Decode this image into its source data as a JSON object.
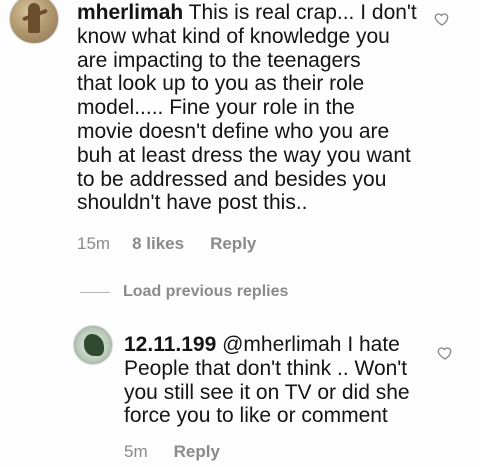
{
  "comment": {
    "username": "mherlimah",
    "lines": [
      "This is real crap... I don't",
      "know what kind of knowledge you",
      "are impacting to the teenagers",
      "that look up to you as their role",
      "model..... Fine your role in the",
      "movie doesn't define who you are",
      "buh at least dress the way you want",
      "to be addressed and besides you",
      "shouldn't have post this.."
    ],
    "time": "15m",
    "likes": "8 likes",
    "reply_label": "Reply"
  },
  "load_previous_label": "Load previous replies",
  "reply": {
    "username": "12.11.199",
    "mention": "@mherlimah",
    "lines": [
      "I hate",
      "People that don't think .. Won't",
      "you still see it on TV or did she",
      "force you to like or comment"
    ],
    "time": "5m",
    "reply_label": "Reply"
  },
  "icons": {
    "like": "heart-outline-icon"
  },
  "colors": {
    "text": "#141414",
    "meta": "#8a8a8a",
    "background": "#fdfdfd"
  }
}
